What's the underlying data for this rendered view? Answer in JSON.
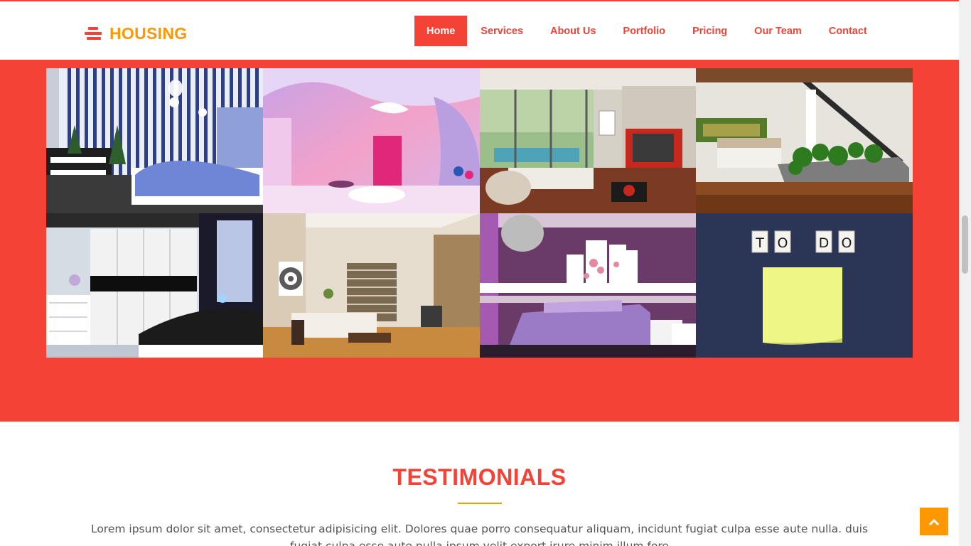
{
  "brand": {
    "name": "HOUSING",
    "icon": "stacked-bars-logo-icon"
  },
  "nav": {
    "items": [
      {
        "label": "Home",
        "active": true
      },
      {
        "label": "Services",
        "active": false
      },
      {
        "label": "About Us",
        "active": false
      },
      {
        "label": "Portfolio",
        "active": false
      },
      {
        "label": "Pricing",
        "active": false
      },
      {
        "label": "Our Team",
        "active": false
      },
      {
        "label": "Contact",
        "active": false
      }
    ]
  },
  "gallery": {
    "images": [
      "striped-blue-bedroom",
      "pink-futuristic-interior",
      "modern-living-room-with-pool-view",
      "indoor-garden-bedroom",
      "white-wardrobe-bedroom",
      "beige-living-room",
      "purple-bedroom",
      "todo-sticky-note-board"
    ]
  },
  "testimonials": {
    "title": "TESTIMONIALS",
    "text": "Lorem ipsum dolor sit amet, consectetur adipisicing elit. Dolores quae porro consequatur aliquam, incidunt fugiat culpa esse aute nulla. duis fugiat culpa esse aute nulla ipsum velit export irure minim illum fore"
  },
  "back_to_top": {
    "icon": "chevron-up-icon"
  },
  "colors": {
    "primary": "#f44336",
    "accent": "#ff9800",
    "body_text": "#555555"
  }
}
